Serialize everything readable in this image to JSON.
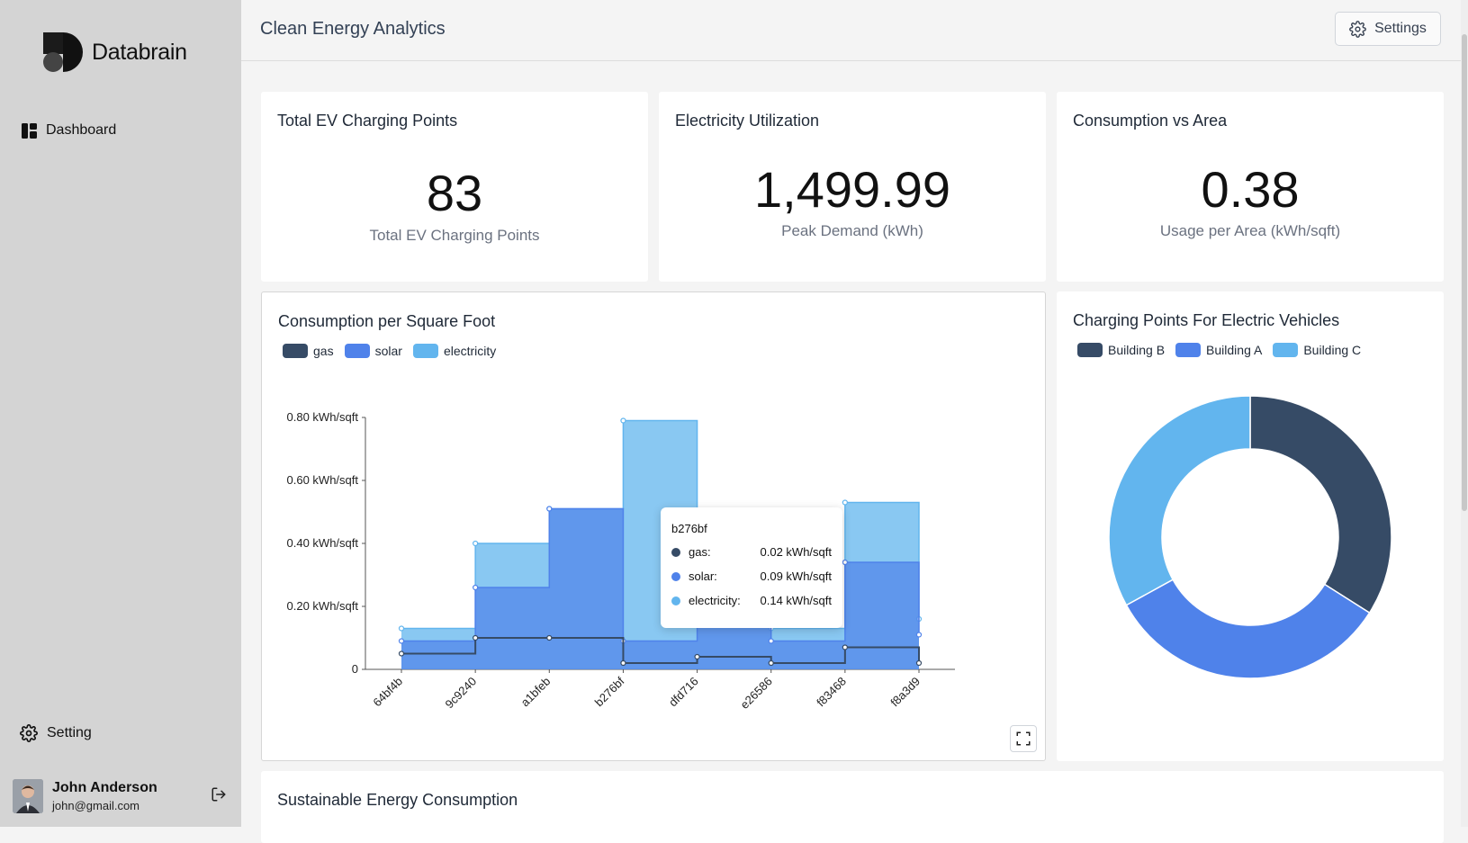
{
  "brand": {
    "name": "Databrain"
  },
  "sidebar": {
    "dashboard_label": "Dashboard",
    "setting_label": "Setting"
  },
  "user": {
    "name": "John Anderson",
    "email": "john@gmail.com"
  },
  "header": {
    "title": "Clean Energy Analytics",
    "settings_label": "Settings"
  },
  "kpis": [
    {
      "title": "Total EV Charging Points",
      "value": "83",
      "subtitle": "Total EV Charging Points"
    },
    {
      "title": "Electricity Utilization",
      "value": "1,499.99",
      "subtitle": "Peak Demand (kWh)"
    },
    {
      "title": "Consumption vs Area",
      "value": "0.38",
      "subtitle": "Usage per Area (kWh/sqft)"
    }
  ],
  "bottom_card": {
    "title": "Sustainable Energy Consumption"
  },
  "colors": {
    "gas": "#364b66",
    "solar": "#4f82ea",
    "electricity": "#62b5ee"
  },
  "tooltip": {
    "title": "b276bf",
    "rows": [
      {
        "label": "gas:",
        "value": "0.02 kWh/sqft"
      },
      {
        "label": "solar:",
        "value": "0.09 kWh/sqft"
      },
      {
        "label": "electricity:",
        "value": "0.14 kWh/sqft"
      }
    ]
  },
  "chart_data": [
    {
      "type": "area",
      "step": true,
      "title": "Consumption per Square Foot",
      "categories": [
        "64bf4b",
        "9c9240",
        "a1bfeb",
        "b276bf",
        "dfd716",
        "e26586",
        "f83468",
        "f8a3d9"
      ],
      "series": [
        {
          "name": "gas",
          "values": [
            0.05,
            0.1,
            0.1,
            0.02,
            0.04,
            0.02,
            0.07,
            0.02
          ]
        },
        {
          "name": "solar",
          "values": [
            0.09,
            0.26,
            0.51,
            0.09,
            0.17,
            0.09,
            0.34,
            0.11
          ]
        },
        {
          "name": "electricity",
          "values": [
            0.13,
            0.4,
            0.51,
            0.79,
            0.14,
            0.13,
            0.53,
            0.16
          ]
        }
      ],
      "y_ticks": [
        "0",
        "0.20 kWh/sqft",
        "0.40 kWh/sqft",
        "0.60 kWh/sqft",
        "0.80 kWh/sqft"
      ],
      "ylim": [
        0,
        0.8
      ],
      "legend": "top-left"
    },
    {
      "type": "pie",
      "donut": true,
      "title": "Charging Points For Electric Vehicles",
      "categories": [
        "Building B",
        "Building A",
        "Building C"
      ],
      "values": [
        34,
        33,
        33
      ],
      "legend": "top-left"
    }
  ]
}
